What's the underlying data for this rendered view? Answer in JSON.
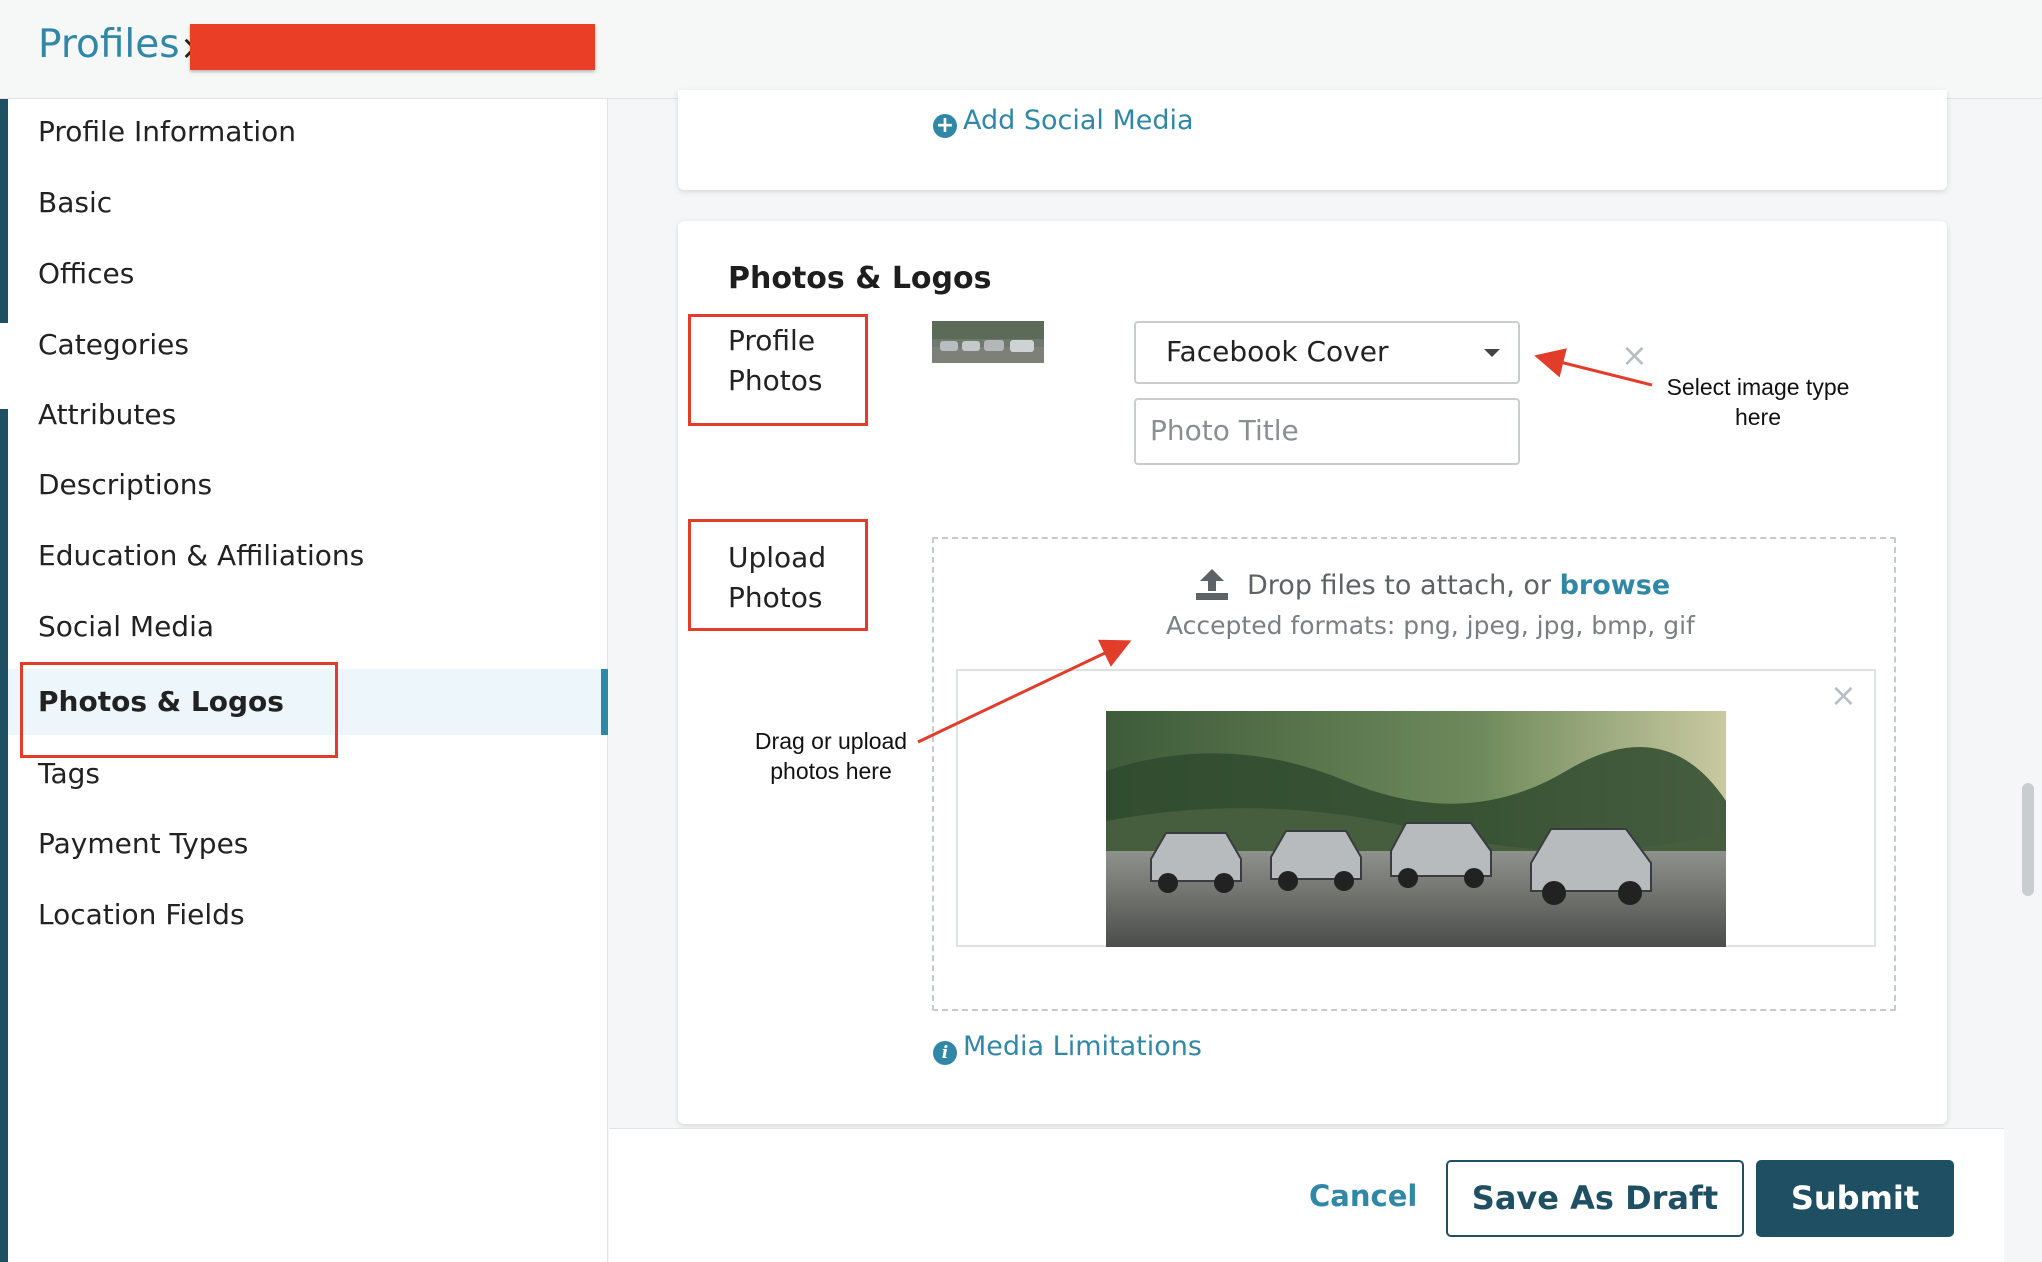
{
  "header": {
    "title": "Profiles",
    "close_glyph": "×"
  },
  "sidebar": {
    "items": [
      {
        "label": "Profile Information"
      },
      {
        "label": "Basic"
      },
      {
        "label": "Offices"
      },
      {
        "label": "Categories"
      },
      {
        "label": "Attributes"
      },
      {
        "label": "Descriptions"
      },
      {
        "label": "Education & Affiliations"
      },
      {
        "label": "Social Media"
      },
      {
        "label": "Photos & Logos",
        "active": true
      },
      {
        "label": "Tags"
      },
      {
        "label": "Payment Types"
      },
      {
        "label": "Location Fields"
      }
    ]
  },
  "social": {
    "add_link": "Add Social Media"
  },
  "photos": {
    "section_title": "Photos & Logos",
    "profile_photos_label": "Profile Photos",
    "upload_photos_label": "Upload Photos",
    "image_type_selected": "Facebook Cover",
    "photo_title_placeholder": "Photo Title",
    "drop_text": "Drop files to attach, or",
    "browse_link": "browse",
    "accepted_formats": "Accepted formats: png, jpeg, jpg, bmp, gif",
    "media_limitations_link": "Media Limitations",
    "remove_glyph": "×"
  },
  "annotations": {
    "select_note": "Select image type here",
    "drag_note": "Drag or upload photos here",
    "color": "#e23c2a"
  },
  "footer": {
    "cancel_label": "Cancel",
    "save_draft_label": "Save As Draft",
    "submit_label": "Submit"
  },
  "colors": {
    "accent": "#3187a6",
    "primary_button": "#1f4f63",
    "redaction": "#ea3e26"
  }
}
